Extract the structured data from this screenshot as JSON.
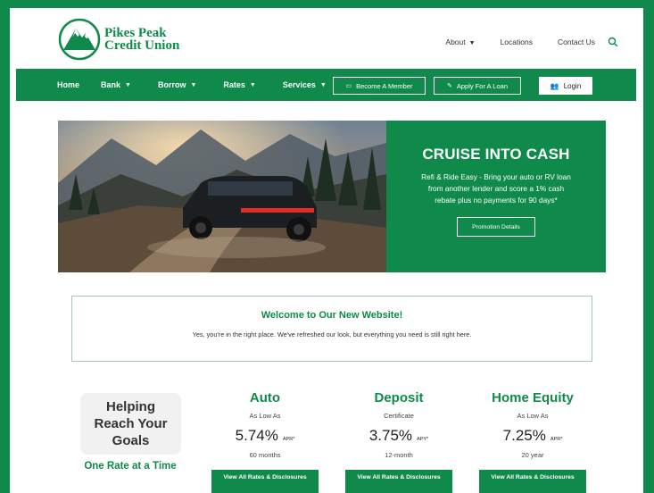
{
  "brand": {
    "name_line1": "Pikes Peak",
    "name_line2": "Credit Union",
    "color": "#0f8a4a"
  },
  "utility_nav": {
    "about": "About",
    "locations": "Locations",
    "contact": "Contact Us"
  },
  "main_nav": {
    "items": [
      "Home",
      "Bank",
      "Borrow",
      "Rates",
      "Services"
    ],
    "become_member": "Become A Member",
    "apply_loan": "Apply For A Loan",
    "login": "Login"
  },
  "hero": {
    "title": "CRUISE INTO CASH",
    "text": "Refi & Ride Easy - Bring your auto or RV loan from another lender and score a 1% cash rebate plus no payments for 90 days*",
    "button": "Promotion Details"
  },
  "welcome": {
    "title": "Welcome to Our New Website!",
    "text": "Yes, you're in the right place. We've refreshed our look, but everything you need is still right here."
  },
  "goals": {
    "line1": "Helping",
    "line2": "Reach Your",
    "line3": "Goals",
    "tagline": "One Rate at a Time"
  },
  "rates": [
    {
      "title": "Auto",
      "sub": "As Low As",
      "value": "5.74%",
      "suffix": "APR*",
      "term": "60 months",
      "button": "View All Rates & Disclosures"
    },
    {
      "title": "Deposit",
      "sub": "Certificate",
      "value": "3.75%",
      "suffix": "APY*",
      "term": "12-month",
      "button": "View All Rates & Disclosures"
    },
    {
      "title": "Home Equity",
      "sub": "As Low As",
      "value": "7.25%",
      "suffix": "APR*",
      "term": "20 year",
      "button": "View All Rates & Disclosures"
    }
  ]
}
